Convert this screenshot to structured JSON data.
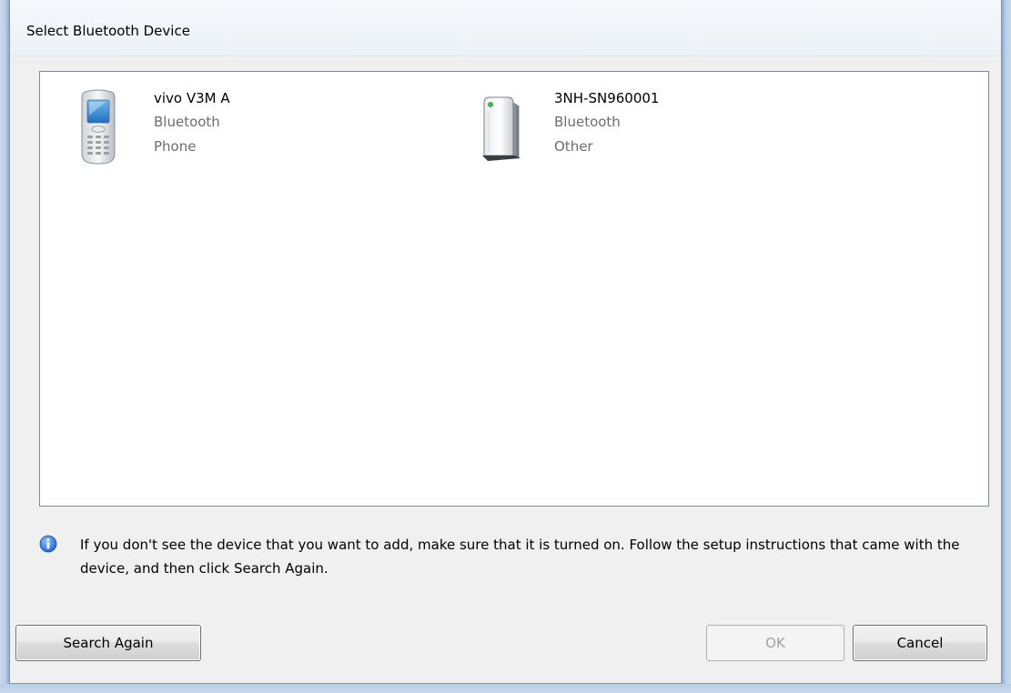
{
  "dialog": {
    "title": "Select Bluetooth Device"
  },
  "devices": [
    {
      "name": "vivo V3M A",
      "type": "Bluetooth",
      "category": "Phone",
      "icon": "mobile-phone-icon"
    },
    {
      "name": "3NH-SN960001",
      "type": "Bluetooth",
      "category": "Other",
      "icon": "generic-device-icon"
    }
  ],
  "info": {
    "icon": "info-icon",
    "text": "If you don't see the device that you want to add, make sure that it is turned on. Follow the setup instructions that came with the device, and then click Search Again."
  },
  "buttons": {
    "search_again": "Search Again",
    "ok": "OK",
    "ok_enabled": false,
    "cancel": "Cancel"
  }
}
